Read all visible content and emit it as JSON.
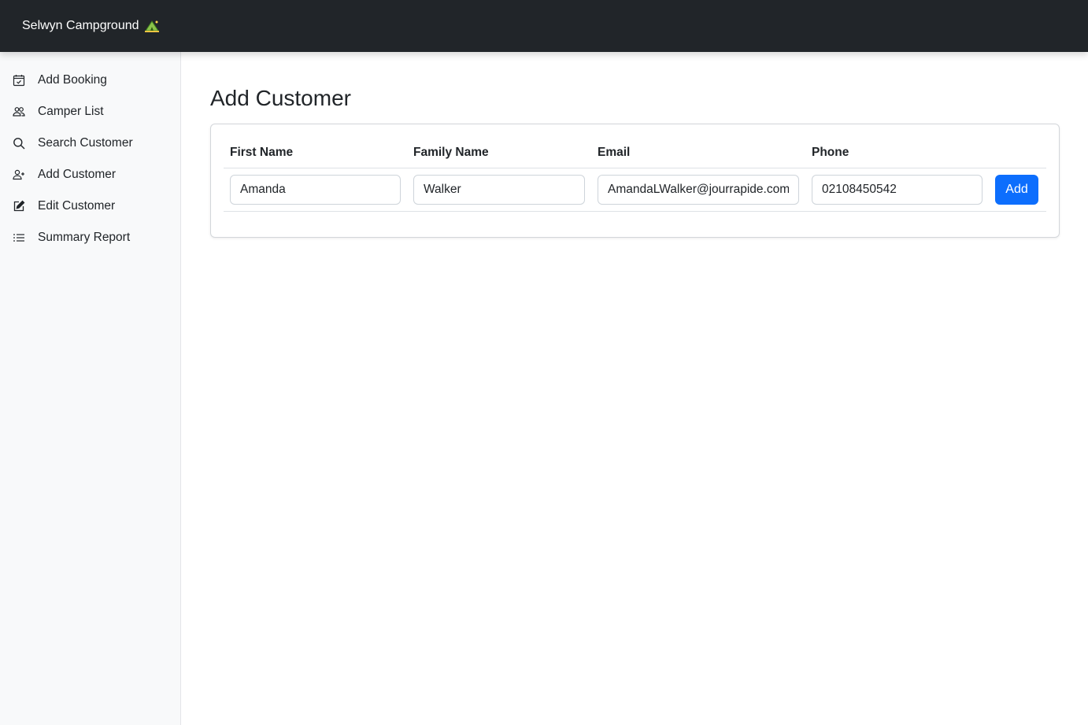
{
  "navbar": {
    "brand": "Selwyn Campground",
    "brand_icon": "camping-tent-icon"
  },
  "sidebar": {
    "items": [
      {
        "label": "Add Booking",
        "icon": "calendar-check-icon"
      },
      {
        "label": "Camper List",
        "icon": "people-icon"
      },
      {
        "label": "Search Customer",
        "icon": "search-icon"
      },
      {
        "label": "Add Customer",
        "icon": "person-plus-icon"
      },
      {
        "label": "Edit Customer",
        "icon": "pencil-square-icon"
      },
      {
        "label": "Summary Report",
        "icon": "list-icon"
      }
    ]
  },
  "main": {
    "title": "Add Customer",
    "table": {
      "headers": [
        "First Name",
        "Family Name",
        "Email",
        "Phone"
      ],
      "values": {
        "first_name": "Amanda",
        "family_name": "Walker",
        "email": "AmandaLWalker@jourrapide.com",
        "phone": "02108450542"
      },
      "add_label": "Add"
    }
  },
  "colors": {
    "navbar_bg": "#212529",
    "sidebar_bg": "#f8f9fa",
    "primary": "#0d6efd"
  }
}
